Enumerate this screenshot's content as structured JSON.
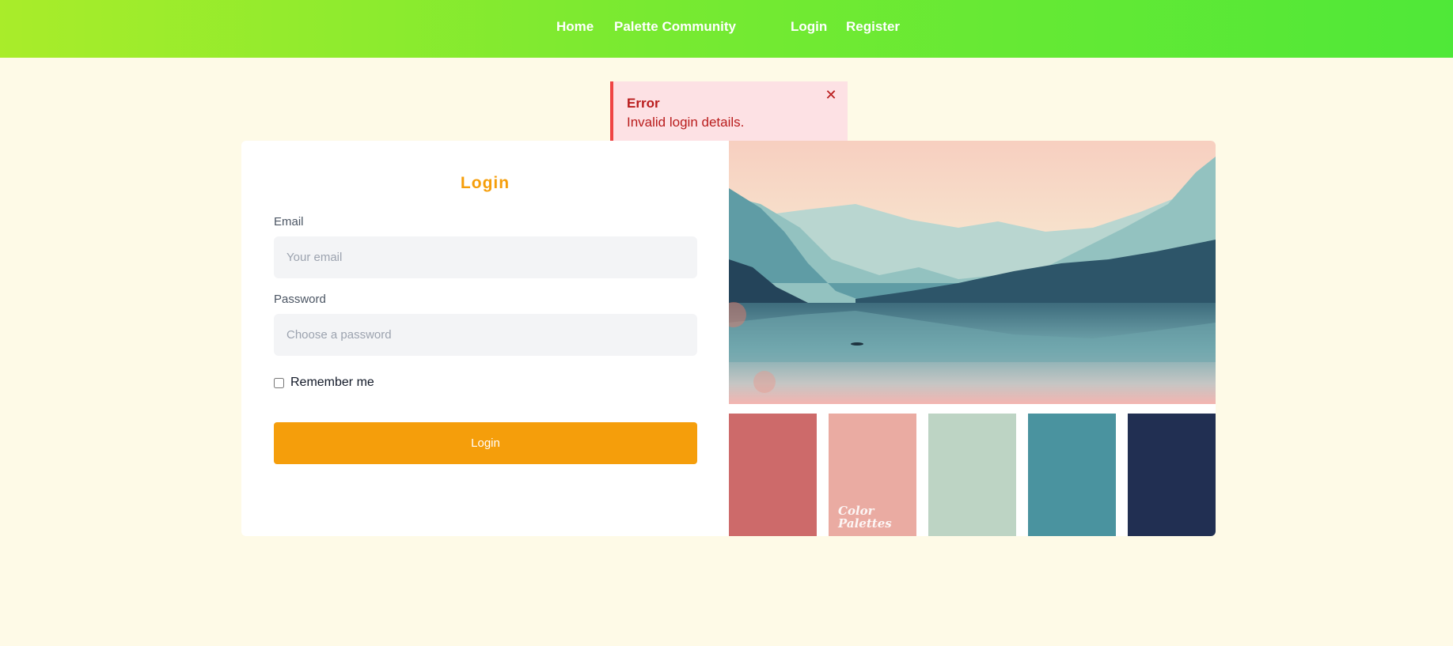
{
  "nav": {
    "home": "Home",
    "community": "Palette Community",
    "login": "Login",
    "register": "Register"
  },
  "alert": {
    "title": "Error",
    "message": "Invalid login details.",
    "close_icon": "close-icon"
  },
  "form": {
    "title": "Login",
    "email_label": "Email",
    "email_placeholder": "Your email",
    "password_label": "Password",
    "password_placeholder": "Choose a password",
    "remember_label": "Remember me",
    "submit_label": "Login"
  },
  "palette": {
    "colors": [
      "#cd6a6a",
      "#eaaba2",
      "#bdd4c4",
      "#4a939f",
      "#212f52"
    ],
    "watermark_line1": "Color",
    "watermark_line2": "Palettes"
  },
  "theme": {
    "accent": "#f59e0b",
    "page_background": "#fefae7",
    "error": "#b91c1c"
  }
}
